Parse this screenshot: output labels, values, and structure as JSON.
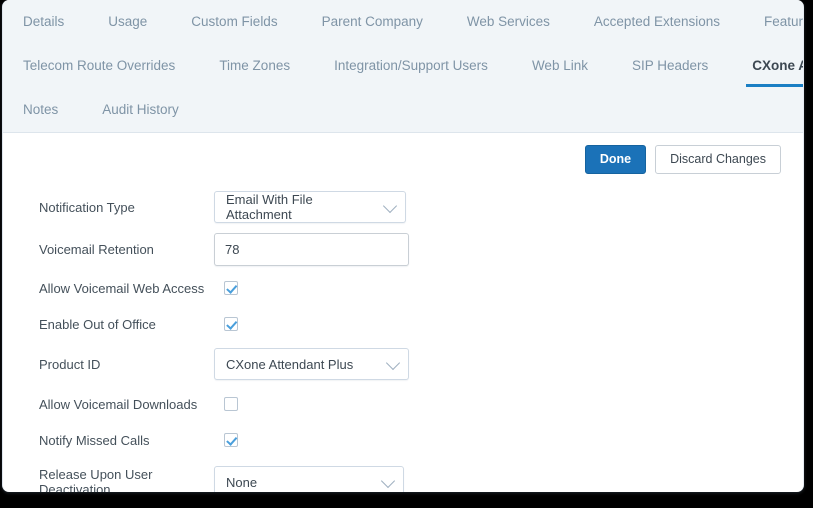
{
  "tabs": {
    "row1": [
      {
        "label": "Details",
        "active": false
      },
      {
        "label": "Usage",
        "active": false
      },
      {
        "label": "Custom Fields",
        "active": false
      },
      {
        "label": "Parent Company",
        "active": false
      },
      {
        "label": "Web Services",
        "active": false
      },
      {
        "label": "Accepted Extensions",
        "active": false
      },
      {
        "label": "Features",
        "active": false
      }
    ],
    "row2": [
      {
        "label": "Telecom Route Overrides",
        "active": false
      },
      {
        "label": "Time Zones",
        "active": false
      },
      {
        "label": "Integration/Support Users",
        "active": false
      },
      {
        "label": "Web Link",
        "active": false
      },
      {
        "label": "SIP Headers",
        "active": false
      },
      {
        "label": "CXone Attendant",
        "active": true
      }
    ],
    "row3": [
      {
        "label": "Notes",
        "active": false
      },
      {
        "label": "Audit History",
        "active": false
      }
    ]
  },
  "actions": {
    "done_label": "Done",
    "discard_label": "Discard Changes"
  },
  "form": {
    "notification_type": {
      "label": "Notification Type",
      "value": "Email With File Attachment"
    },
    "voicemail_retention": {
      "label": "Voicemail Retention",
      "value": "78"
    },
    "allow_voicemail_web_access": {
      "label": "Allow Voicemail Web Access",
      "checked": true
    },
    "enable_out_of_office": {
      "label": "Enable Out of Office",
      "checked": true
    },
    "product_id": {
      "label": "Product ID",
      "value": "CXone Attendant Plus"
    },
    "allow_voicemail_downloads": {
      "label": "Allow Voicemail Downloads",
      "checked": false
    },
    "notify_missed_calls": {
      "label": "Notify Missed Calls",
      "checked": true
    },
    "release_upon_user_deactivation": {
      "label": "Release Upon User Deactivation",
      "value": "None"
    }
  },
  "colors": {
    "accent_blue": "#1b7fc4",
    "primary_button": "#1b72b8",
    "header_bg": "#f1f5f8",
    "tab_text": "#7f94a6",
    "check_blue": "#4a9fdc"
  },
  "icons": {
    "chevron_down": "chevron-down-icon",
    "check": "check-icon"
  }
}
